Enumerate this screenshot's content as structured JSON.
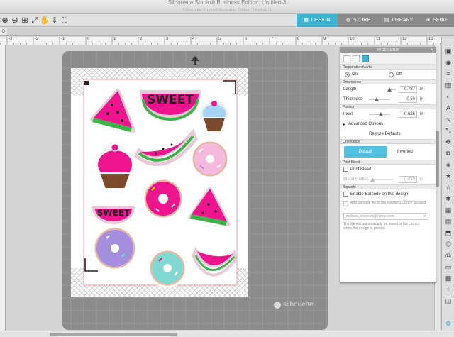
{
  "app": {
    "title": "Silhouette Studio® Business Edition: Untitled-3",
    "subtitle": "Silhouette Studio® Business Edition: Untitled-3"
  },
  "nav": {
    "design": "DESIGN",
    "store": "STORE",
    "library": "LIBRARY",
    "send": "SEND"
  },
  "tabs": {
    "first": "8"
  },
  "ruler": {
    "labels": [
      "-3",
      "-2",
      "-1",
      "0",
      "1",
      "2",
      "3",
      "4",
      "5",
      "6",
      "7",
      "8",
      "9",
      "10",
      "11",
      "12",
      "13"
    ]
  },
  "stickers": {
    "sweet_text": "SWEET",
    "sweet_text_2": "SWEET"
  },
  "watermark": "silhouette",
  "panel": {
    "title": "PAGE SETUP",
    "registration_marks": "Registration Marks",
    "on": "On",
    "off": "Off",
    "dimensions": "Dimensions",
    "length_label": "Length",
    "length_value": "0.787",
    "thickness_label": "Thickness",
    "thickness_value": "0.50",
    "position": "Position",
    "inset_label": "Inset",
    "inset_value": "0.625",
    "unit_in": "in",
    "advanced": "Advanced Options",
    "restore": "Restore Defaults",
    "orientation": "Orientation",
    "default_btn": "Default",
    "inverted": "Inverted",
    "print_bleed_section": "Print Bleed",
    "print_bleed": "Print Bleed",
    "bleed_radius": "Bleed Radius",
    "bleed_value": "0.050",
    "barcode_section": "Barcode",
    "enable_barcode": "Enable Barcode on this design",
    "add_barcode": "Add barcode file to the following Library account",
    "account": "melissa_viscount@yahoo.com",
    "note": "The file will automatically be saved to the Library when the design is printed."
  },
  "colors": {
    "accent": "#3fb5d6",
    "pink": "#f0138e",
    "green": "#3db34a",
    "teal": "#7fd9d1",
    "lavender": "#a58de0"
  }
}
